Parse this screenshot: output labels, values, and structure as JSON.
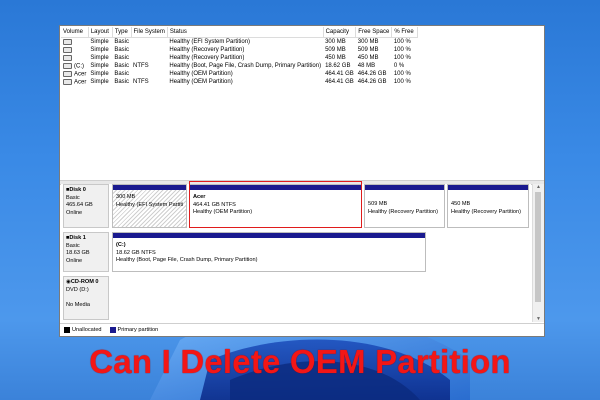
{
  "columns": [
    "Volume",
    "Layout",
    "Type",
    "File System",
    "Status",
    "Capacity",
    "Free Space",
    "% Free"
  ],
  "volumes": [
    {
      "volume": "",
      "layout": "Simple",
      "type": "Basic",
      "fs": "",
      "status": "Healthy (EFI System Partition)",
      "capacity": "300 MB",
      "free": "300 MB",
      "pct": "100 %"
    },
    {
      "volume": "",
      "layout": "Simple",
      "type": "Basic",
      "fs": "",
      "status": "Healthy (Recovery Partition)",
      "capacity": "509 MB",
      "free": "509 MB",
      "pct": "100 %"
    },
    {
      "volume": "",
      "layout": "Simple",
      "type": "Basic",
      "fs": "",
      "status": "Healthy (Recovery Partition)",
      "capacity": "450 MB",
      "free": "450 MB",
      "pct": "100 %"
    },
    {
      "volume": "(C:)",
      "layout": "Simple",
      "type": "Basic",
      "fs": "NTFS",
      "status": "Healthy (Boot, Page File, Crash Dump, Primary Partition)",
      "capacity": "18.62 GB",
      "free": "48 MB",
      "pct": "0 %"
    },
    {
      "volume": "Acer",
      "layout": "Simple",
      "type": "Basic",
      "fs": "",
      "status": "Healthy (OEM Partition)",
      "capacity": "464.41 GB",
      "free": "464.26 GB",
      "pct": "100 %"
    },
    {
      "volume": "Acer",
      "layout": "Simple",
      "type": "Basic",
      "fs": "NTFS",
      "status": "Healthy (OEM Partition)",
      "capacity": "464.41 GB",
      "free": "464.26 GB",
      "pct": "100 %"
    }
  ],
  "disks": [
    {
      "name": "Disk 0",
      "kind": "Basic",
      "size": "465.64 GB",
      "state": "Online",
      "partitions": [
        {
          "title": "",
          "size": "300 MB",
          "status": "Healthy (EFI System Partiti"
        },
        {
          "title": "Acer",
          "size": "464.41 GB NTFS",
          "status": "Healthy (OEM Partition)"
        },
        {
          "title": "",
          "size": "509 MB",
          "status": "Healthy (Recovery Partition)"
        },
        {
          "title": "",
          "size": "450 MB",
          "status": "Healthy (Recovery Partition)"
        }
      ]
    },
    {
      "name": "Disk 1",
      "kind": "Basic",
      "size": "18.63 GB",
      "state": "Online",
      "partitions": [
        {
          "title": "(C:)",
          "size": "18.62 GB NTFS",
          "status": "Healthy (Boot, Page File, Crash Dump, Primary Partition)"
        }
      ]
    },
    {
      "name": "CD-ROM 0",
      "kind": "DVD (D:)",
      "size": "",
      "state": "No Media",
      "partitions": []
    }
  ],
  "legend": {
    "unallocated": "Unallocated",
    "primary": "Primary partition"
  },
  "colors": {
    "primary_bar": "#1a1a8f",
    "highlight": "#e01c1c",
    "headline": "#f31616"
  },
  "headline": "Can I Delete OEM Partition"
}
